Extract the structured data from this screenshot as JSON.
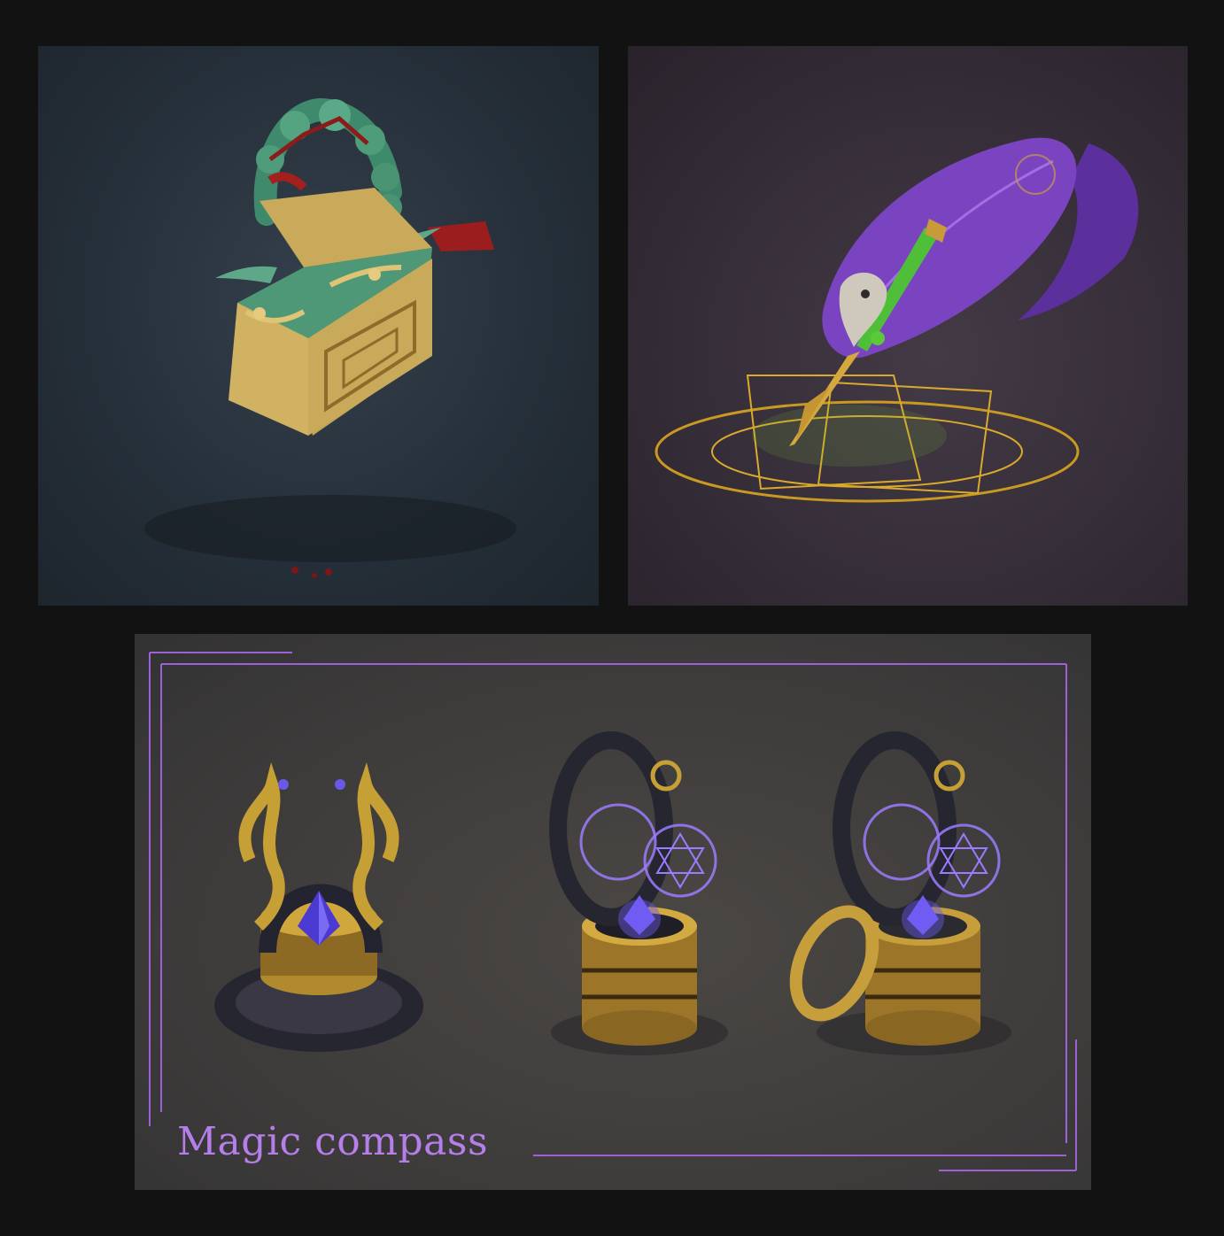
{
  "colors": {
    "page_bg": "#121212",
    "frame_line": "#9a62d6",
    "title_text": "#b57ee8"
  },
  "panels": [
    {
      "icon": "padlock-icon"
    },
    {
      "icon": "quill-pen-icon"
    },
    {
      "icon": "magic-compass-icon",
      "title": "Magic compass"
    }
  ]
}
